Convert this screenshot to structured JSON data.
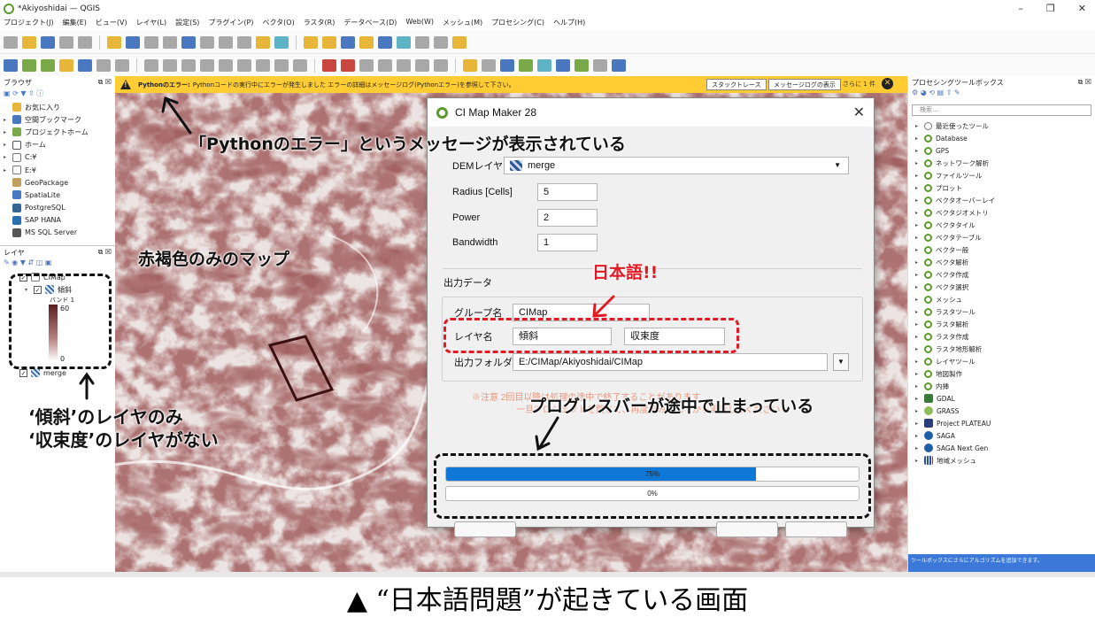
{
  "window": {
    "title": "*Akiyoshidai — QGIS",
    "controls": [
      "–",
      "❐",
      "✕"
    ]
  },
  "menu": [
    "プロジェクト(J)",
    "編集(E)",
    "ビュー(V)",
    "レイヤ(L)",
    "設定(S)",
    "プラグイン(P)",
    "ベクタ(O)",
    "ラスタ(R)",
    "データベース(D)",
    "Web(W)",
    "メッシュ(M)",
    "プロセシング(C)",
    "ヘルプ(H)"
  ],
  "browser": {
    "title": "ブラウザ",
    "items": [
      "お気に入り",
      "空間ブックマーク",
      "プロジェクトホーム",
      "ホーム",
      "C:¥",
      "E:¥",
      "GeoPackage",
      "SpatiaLite",
      "PostgreSQL",
      "SAP HANA",
      "MS SQL Server"
    ]
  },
  "layers": {
    "title": "レイヤ",
    "group": "CIMap",
    "layer": "傾斜",
    "band": "バンド 1",
    "max": "60",
    "min": "0",
    "other": "merge"
  },
  "error_bar": {
    "prefix": "Pythonのエラー:",
    "message": "Pythonコードの実行中にエラーが発生しました エラーの詳細はメッセージログ(Pythonエラー)を参照して下さい。",
    "btn_stack": "スタックトレース",
    "btn_log": "メッセージログの表示",
    "btn_more": "さらに 1 件"
  },
  "dialog": {
    "title": "CI Map Maker 28",
    "dem_label": "DEMレイヤ",
    "dem_value": "merge",
    "radius_label": "Radius [Cells]",
    "radius_value": "5",
    "power_label": "Power",
    "power_value": "2",
    "bandwidth_label": "Bandwidth",
    "bandwidth_value": "1",
    "output_title": "出力データ",
    "group_label": "グループ名",
    "group_value": "CIMap",
    "layer_label": "レイヤ名",
    "layer_value1": "傾斜",
    "layer_value2": "収束度",
    "folder_label": "出力フォルダ",
    "folder_value": "E:/CIMap/Akiyoshidai/CIMap",
    "note_line1": "※注意 2回目以降は処理の途中で終了することがあります",
    "note_line2": "一旦プロジェクトを閉じて、再度読み込んでから実行してください",
    "progress1": 0.75,
    "progress1_label": "75%",
    "progress2": 0,
    "progress2_label": "0%"
  },
  "toolbox": {
    "title": "プロセシングツールボックス",
    "search_placeholder": "検索...",
    "items": [
      "最近使ったツール",
      "Database",
      "GPS",
      "ネットワーク解析",
      "ファイルツール",
      "プロット",
      "ベクタオーバーレイ",
      "ベクタジオメトリ",
      "ベクタタイル",
      "ベクタテーブル",
      "ベクター般",
      "ベクタ解析",
      "ベクタ作成",
      "ベクタ選択",
      "メッシュ",
      "ラスタツール",
      "ラスタ解析",
      "ラスタ作成",
      "ラスタ地形解析",
      "レイヤツール",
      "地図製作",
      "内挿",
      "GDAL",
      "GRASS",
      "Project PLATEAU",
      "SAGA",
      "SAGA Next Gen",
      "地域メッシュ"
    ],
    "footer": "ツールボックスにさらにアルゴリズムを追加できます。"
  },
  "annotations": {
    "python_error": "「Pythonのエラー」というメッセージが表示されている",
    "map_note": "赤褐色のみのマップ",
    "japanese": "日本語!!",
    "progress_stuck": "プログレスバーが途中で止まっている",
    "layer_note1": "‘傾斜’のレイヤのみ",
    "layer_note2": "‘収束度’のレイヤがない"
  },
  "caption": "▲ “日本語問題”が起きている画面",
  "colors": {
    "error_bar": "#ffcc33",
    "progress": "#0f78d7",
    "map_dark": "#6b2a2a",
    "annotation_red": "#e01b24"
  }
}
